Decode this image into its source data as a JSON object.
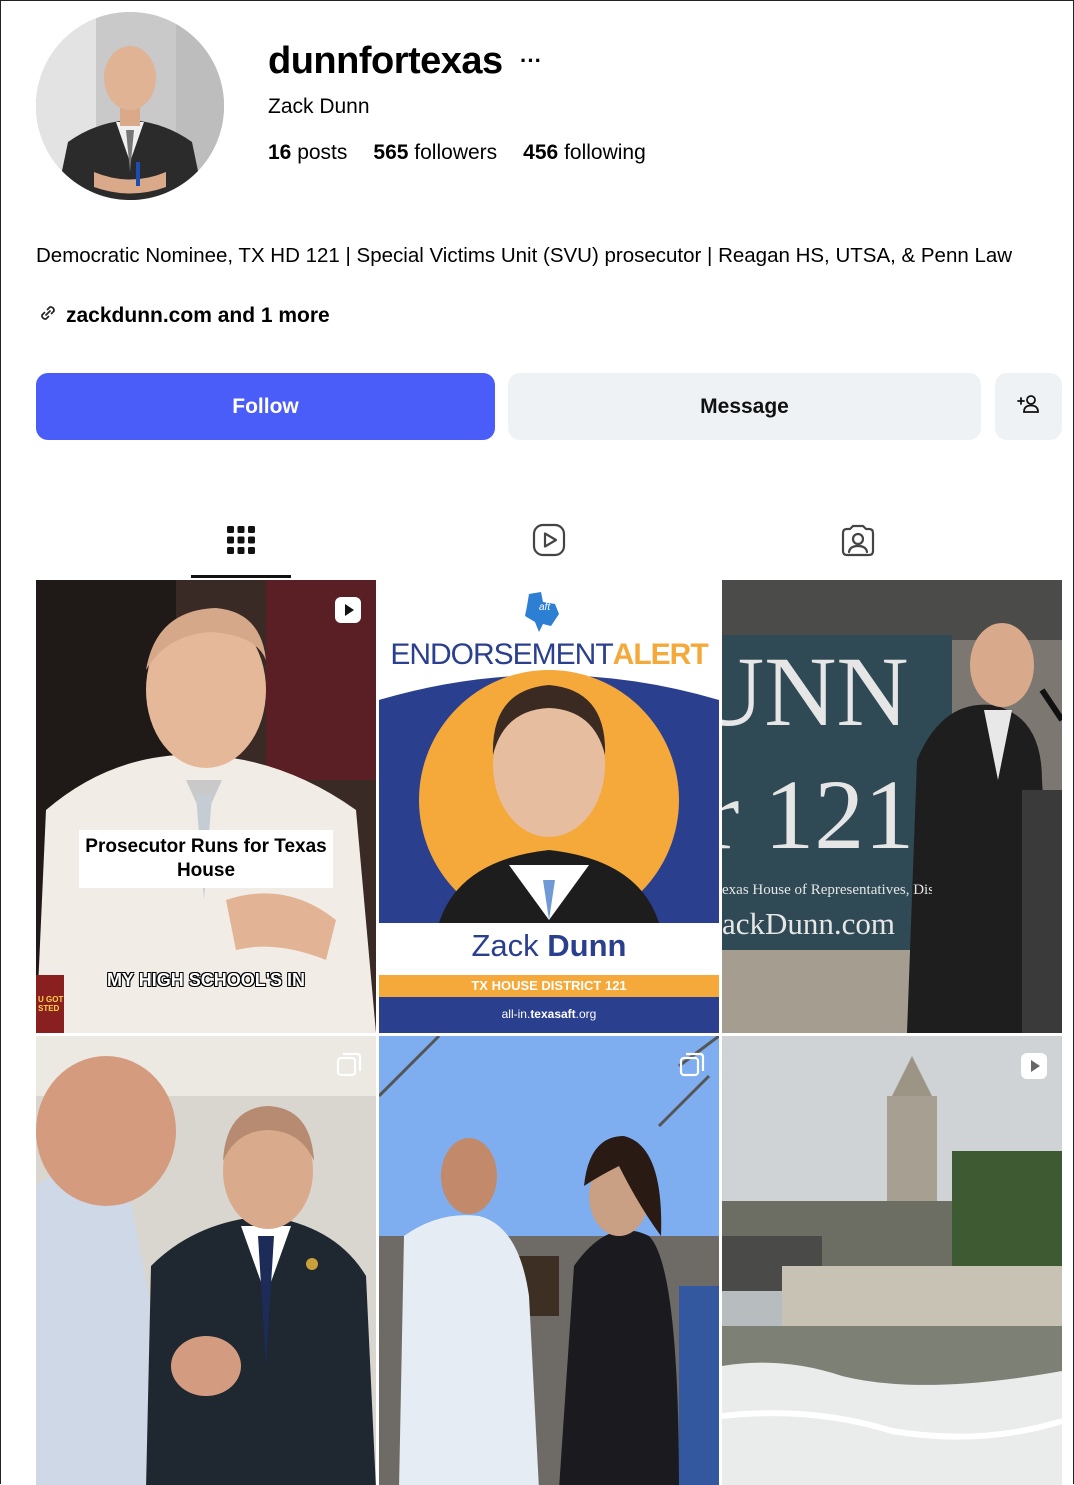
{
  "profile": {
    "username": "dunnfortexas",
    "more_label": "···",
    "full_name": "Zack Dunn",
    "stats": {
      "posts_count": "16",
      "posts_label": "posts",
      "followers_count": "565",
      "followers_label": "followers",
      "following_count": "456",
      "following_label": "following"
    },
    "bio": "Democratic Nominee, TX HD 121 | Special Victims Unit (SVU) prosecutor | Reagan HS, UTSA, & Penn Law",
    "link_text": "zackdunn.com and 1 more"
  },
  "actions": {
    "follow_label": "Follow",
    "message_label": "Message"
  },
  "tabs": [
    {
      "name": "posts",
      "icon": "grid-icon",
      "active": true
    },
    {
      "name": "reels",
      "icon": "reels-icon",
      "active": false
    },
    {
      "name": "tagged",
      "icon": "tagged-icon",
      "active": false
    }
  ],
  "posts": [
    {
      "type": "reel",
      "caption_box": "Prosecutor Runs for Texas House",
      "caption_bottom": "MY HIGH SCHOOL'S IN",
      "corner_text": "U GOT\nSTED"
    },
    {
      "type": "image",
      "heading_light": "ENDORSEMENT",
      "heading_bold": "ALERT",
      "logo_text": "aft",
      "name_light": "Zack",
      "name_bold": "Dunn",
      "district": "TX HOUSE DISTRICT 121",
      "url_prefix": "all-in.",
      "url_domain": "texasaft",
      "url_suffix": ".org"
    },
    {
      "type": "image",
      "banner_big": "UNN",
      "banner_num": "r 121",
      "banner_line": "exas House of Representatives, Dis",
      "banner_site": "ackDunn.com"
    },
    {
      "type": "carousel"
    },
    {
      "type": "carousel"
    },
    {
      "type": "reel"
    }
  ],
  "colors": {
    "follow_button": "#4a5df9",
    "secondary_button": "#eff2f5",
    "aft_navy": "#2b3f8f",
    "aft_orange": "#f4a93a",
    "aft_light_blue": "#2d7fd3"
  }
}
